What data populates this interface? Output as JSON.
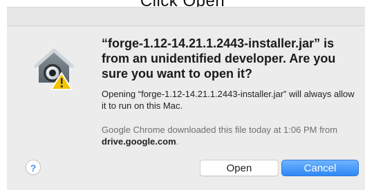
{
  "caption": "Click Open",
  "dialog": {
    "headline": "“forge-1.12-14.21.1.2443-installer.jar” is from an unidentified developer. Are you sure you want to open it?",
    "body": "Opening “forge-1.12-14.21.1.2443-installer.jar” will always allow it to run on this Mac.",
    "info_prefix": "Google Chrome downloaded this file today at 1:06 PM from ",
    "info_domain": "drive.google.com",
    "info_suffix": ".",
    "help_label": "?",
    "open_label": "Open",
    "cancel_label": "Cancel"
  },
  "icons": {
    "app": "gatekeeper-warning-icon",
    "help": "help-icon"
  },
  "colors": {
    "accent": "#2f87f5",
    "warning": "#f5c400"
  }
}
